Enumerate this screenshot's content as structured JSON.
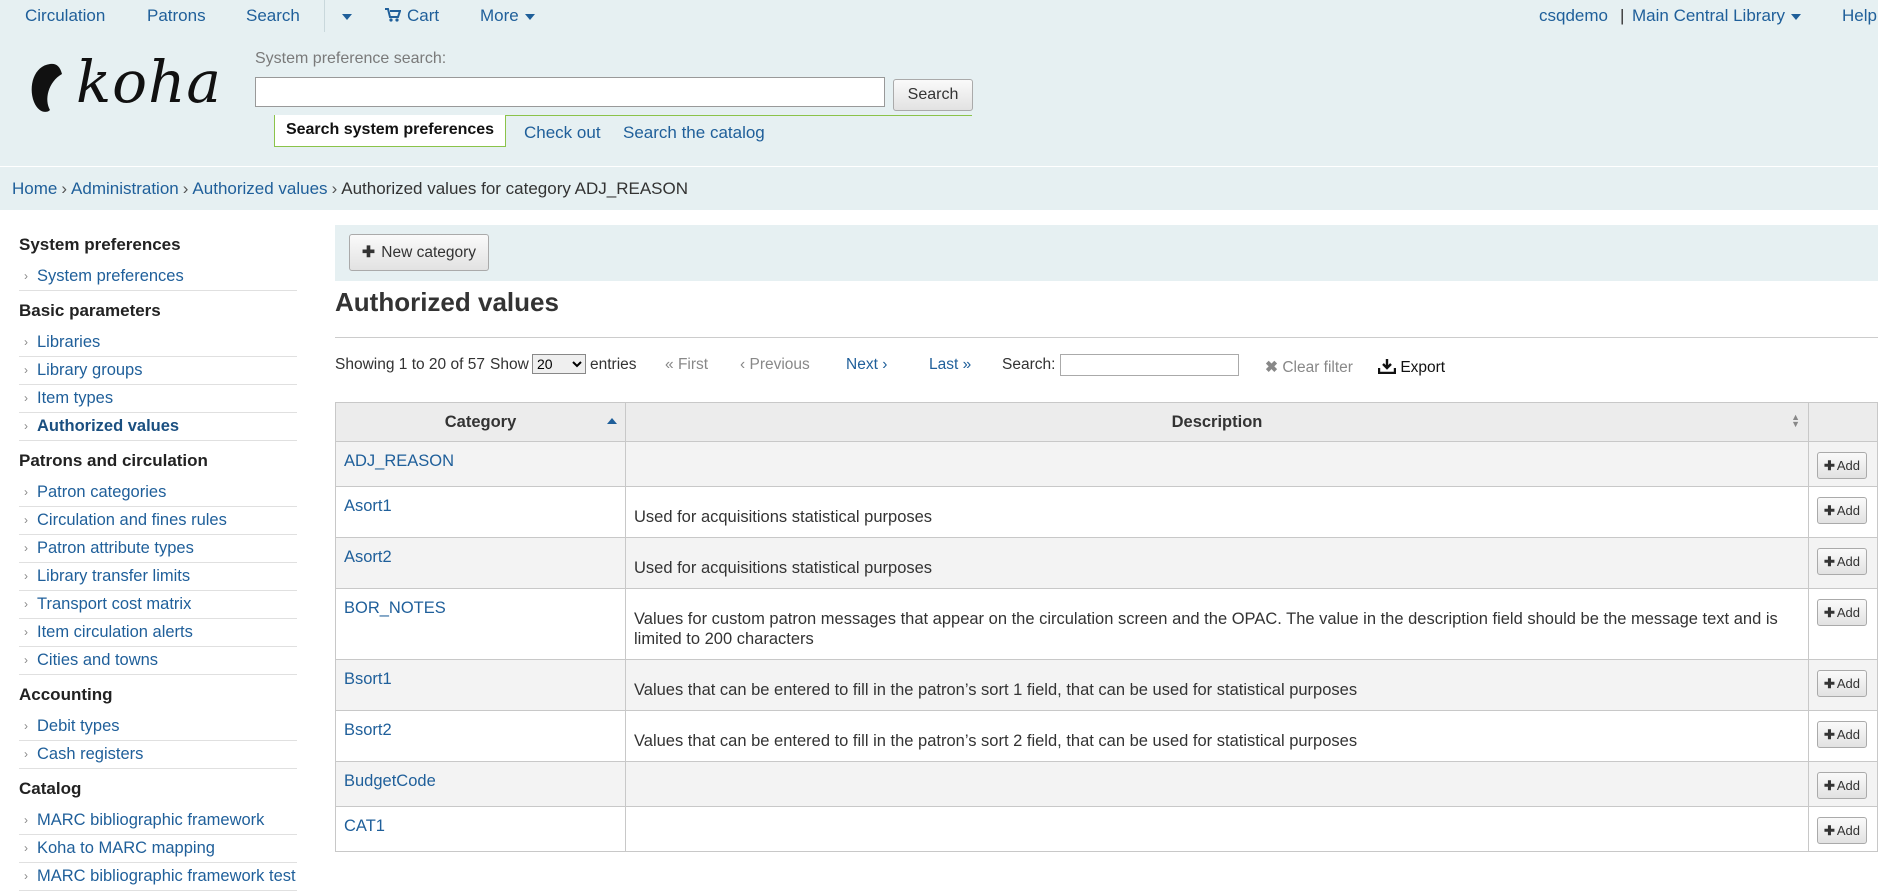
{
  "topnav": {
    "circulation": "Circulation",
    "patrons": "Patrons",
    "search": "Search",
    "cart": "Cart",
    "more": "More",
    "user": "csqdemo",
    "separator": "|",
    "library": "Main Central Library",
    "help": "Help"
  },
  "header": {
    "logo_text": "koha",
    "pref_label": "System preference search:",
    "pref_value": "",
    "search_button": "Search",
    "tab_active": "Search system preferences",
    "tab_checkout": "Check out",
    "tab_catalog": "Search the catalog"
  },
  "breadcrumb": {
    "home": "Home",
    "administration": "Administration",
    "authorized_values": "Authorized values",
    "current": "Authorized values for category ADJ_REASON",
    "separator": "›"
  },
  "sidebar": {
    "groups": [
      {
        "heading": "System preferences",
        "items": [
          {
            "label": "System preferences"
          }
        ]
      },
      {
        "heading": "Basic parameters",
        "items": [
          {
            "label": "Libraries"
          },
          {
            "label": "Library groups"
          },
          {
            "label": "Item types"
          },
          {
            "label": "Authorized values",
            "active": true
          }
        ]
      },
      {
        "heading": "Patrons and circulation",
        "items": [
          {
            "label": "Patron categories"
          },
          {
            "label": "Circulation and fines rules"
          },
          {
            "label": "Patron attribute types"
          },
          {
            "label": "Library transfer limits"
          },
          {
            "label": "Transport cost matrix"
          },
          {
            "label": "Item circulation alerts"
          },
          {
            "label": "Cities and towns"
          }
        ]
      },
      {
        "heading": "Accounting",
        "items": [
          {
            "label": "Debit types"
          },
          {
            "label": "Cash registers"
          }
        ]
      },
      {
        "heading": "Catalog",
        "items": [
          {
            "label": "MARC bibliographic framework"
          },
          {
            "label": "Koha to MARC mapping"
          },
          {
            "label": "MARC bibliographic framework test"
          }
        ]
      }
    ]
  },
  "main": {
    "new_category": "New category",
    "title": "Authorized values",
    "controls": {
      "showing": "Showing 1 to 20 of 57",
      "show": "Show",
      "length": "20",
      "entries": "entries",
      "first": "First",
      "previous": "Previous",
      "next": "Next",
      "last": "Last",
      "search_label": "Search:",
      "search_value": "",
      "clear_filter": "Clear filter",
      "export": "Export"
    },
    "table": {
      "columns": [
        "Category",
        "Description",
        ""
      ],
      "add_label": "Add",
      "rows": [
        {
          "category": "ADJ_REASON",
          "description": ""
        },
        {
          "category": "Asort1",
          "description": "Used for acquisitions statistical purposes"
        },
        {
          "category": "Asort2",
          "description": "Used for acquisitions statistical purposes"
        },
        {
          "category": "BOR_NOTES",
          "description": "Values for custom patron messages that appear on the circulation screen and the OPAC. The value in the description field should be the message text and is limited to 200 characters"
        },
        {
          "category": "Bsort1",
          "description": "Values that can be entered to fill in the patron’s sort 1 field, that can be used for statistical purposes"
        },
        {
          "category": "Bsort2",
          "description": "Values that can be entered to fill in the patron’s sort 2 field, that can be used for statistical purposes"
        },
        {
          "category": "BudgetCode",
          "description": ""
        },
        {
          "category": "CAT1",
          "description": ""
        }
      ]
    }
  },
  "colors": {
    "link": "#1f5f9a",
    "header_bg": "#e6f0f2",
    "accent_green": "#8bc34a"
  }
}
